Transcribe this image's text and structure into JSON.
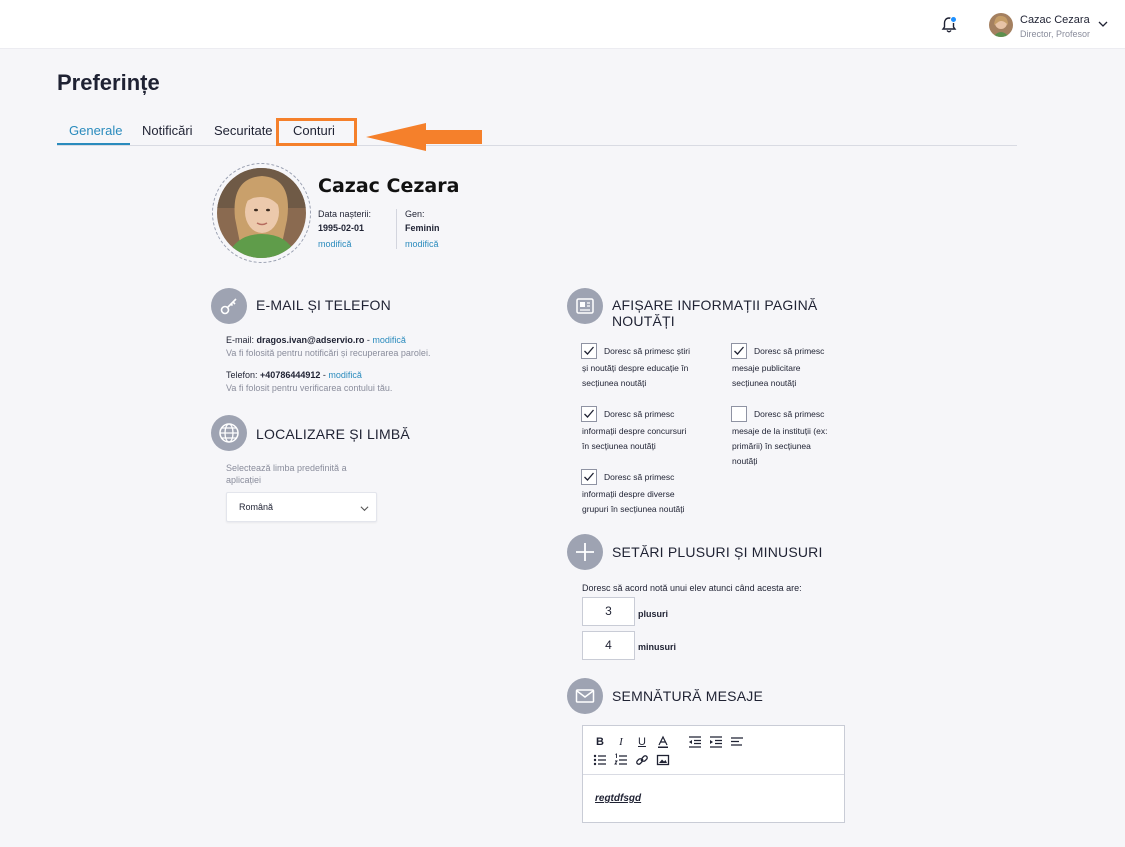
{
  "header": {
    "user_name": "Cazac Cezara",
    "user_role": "Director, Profesor"
  },
  "page_title": "Preferințe",
  "tabs": [
    {
      "label": "Generale",
      "active": true
    },
    {
      "label": "Notificări",
      "active": false
    },
    {
      "label": "Securitate",
      "active": false
    },
    {
      "label": "Conturi",
      "active": false
    }
  ],
  "profile": {
    "name": "Cazac Cezara",
    "birth_label": "Data nașterii:",
    "birth_value": "1995-02-01",
    "gender_label": "Gen:",
    "gender_value": "Feminin",
    "modify_label": "modifică"
  },
  "email_section": {
    "title": "E-MAIL ȘI TELEFON",
    "email_label": "E-mail:",
    "email_value": "dragos.ivan@adservio.ro",
    "email_sep": " - ",
    "modify_label": "modifică",
    "email_hint": "Va fi folosită pentru notificări și recuperarea parolei.",
    "phone_label": "Telefon:",
    "phone_value": "+40786444912",
    "phone_sep": " - ",
    "phone_hint": "Va fi folosit pentru verificarea contului tău."
  },
  "locale_section": {
    "title": "LOCALIZARE ȘI LIMBĂ",
    "select_hint_line1": "Selectează limba predefinită a",
    "select_hint_line2": "aplicației",
    "selected_language": "Română"
  },
  "news_section": {
    "title_line1": "AFIȘARE INFORMAȚII PAGINĂ",
    "title_line2": "NOUTĂȚI",
    "options": [
      {
        "lines": [
          "Doresc să primesc știri",
          "și noutăți despre educație în",
          "secțiunea noutăți"
        ],
        "checked": true
      },
      {
        "lines": [
          "Doresc să primesc",
          "mesaje publicitare",
          "secțiunea noutăți"
        ],
        "checked": true
      },
      {
        "lines": [
          "Doresc să primesc",
          "informații despre concursuri",
          "în secțiunea noutăți"
        ],
        "checked": true
      },
      {
        "lines": [
          "Doresc să primesc",
          "mesaje de la instituții (ex:",
          "primării) în secțiunea",
          "noutăți"
        ],
        "checked": false
      },
      {
        "lines": [
          "Doresc să primesc",
          "informații despre diverse",
          "grupuri în secțiunea noutăți"
        ],
        "checked": true
      }
    ]
  },
  "plus_section": {
    "title": "SETĂRI PLUSURI ȘI MINUSURI",
    "intro": "Doresc să acord notă unui elev atunci când acesta are:",
    "plus_value": "3",
    "plus_label": "plusuri",
    "minus_value": "4",
    "minus_label": "minusuri"
  },
  "signature_section": {
    "title": "SEMNĂTURĂ MESAJE",
    "content": "regtdfsgd"
  },
  "colors": {
    "accent": "#2a8bbd",
    "highlight": "#f5802b",
    "icon_bg": "#9ea3b2"
  }
}
